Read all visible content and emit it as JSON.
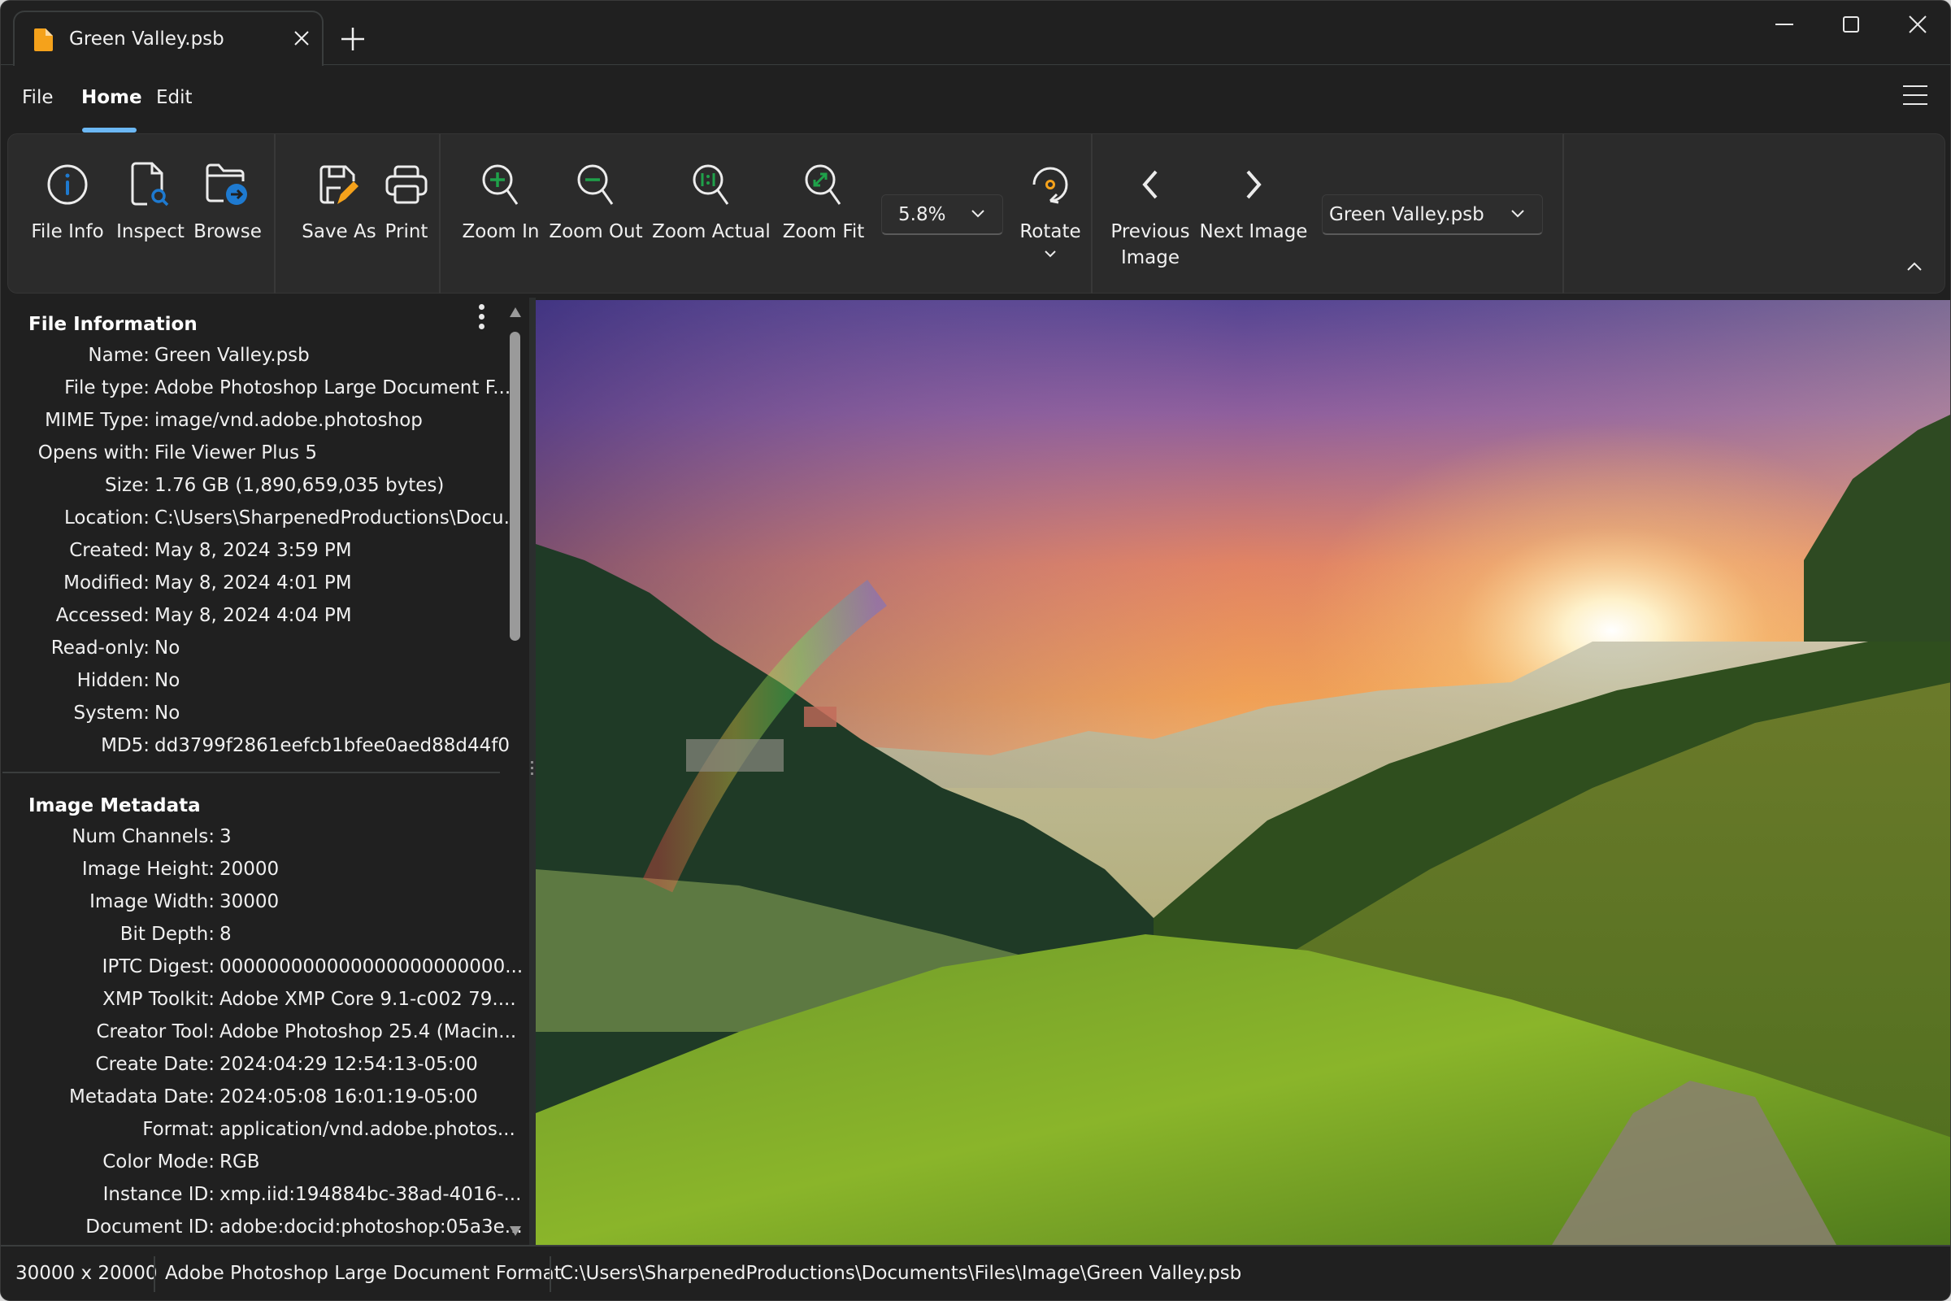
{
  "window": {
    "tab_title": "Green Valley.psb",
    "tab_icon": "document-icon",
    "accent_color": "#6cb8f5",
    "controls": [
      "minimize",
      "maximize",
      "close"
    ]
  },
  "menu": {
    "items": [
      {
        "label": "File"
      },
      {
        "label": "Home",
        "active": true
      },
      {
        "label": "Edit"
      }
    ]
  },
  "ribbon": {
    "groups": [
      {
        "buttons": [
          {
            "label": "File Info",
            "icon": "info-icon"
          },
          {
            "label": "Inspect",
            "icon": "inspect-file-icon"
          },
          {
            "label": "Browse",
            "icon": "browse-folder-icon"
          }
        ]
      },
      {
        "buttons": [
          {
            "label": "Save As",
            "icon": "save-as-icon"
          },
          {
            "label": "Print",
            "icon": "print-icon"
          }
        ]
      },
      {
        "buttons": [
          {
            "label": "Zoom In",
            "icon": "zoom-in-icon"
          },
          {
            "label": "Zoom Out",
            "icon": "zoom-out-icon"
          },
          {
            "label": "Zoom Actual",
            "icon": "zoom-actual-icon"
          },
          {
            "label": "Zoom Fit",
            "icon": "zoom-fit-icon"
          }
        ]
      },
      {
        "buttons": [
          {
            "label": "Previous Image",
            "label_line1": "Previous",
            "label_line2": "Image",
            "icon": "chevron-left-icon"
          },
          {
            "label": "Next Image",
            "icon": "chevron-right-icon"
          }
        ]
      }
    ],
    "zoom_level": "5.8%",
    "rotate_label": "Rotate",
    "image_select": "Green Valley.psb"
  },
  "file_information": {
    "title": "File Information",
    "rows": [
      {
        "key": "Name:",
        "value": "Green Valley.psb"
      },
      {
        "key": "File type:",
        "value": "Adobe Photoshop Large Document F..."
      },
      {
        "key": "MIME Type:",
        "value": "image/vnd.adobe.photoshop"
      },
      {
        "key": "Opens with:",
        "value": "File Viewer Plus 5"
      },
      {
        "key": "Size:",
        "value": "1.76 GB (1,890,659,035 bytes)"
      },
      {
        "key": "Location:",
        "value": "C:\\Users\\SharpenedProductions\\Docu..."
      },
      {
        "key": "Created:",
        "value": "May 8, 2024 3:59 PM"
      },
      {
        "key": "Modified:",
        "value": "May 8, 2024 4:01 PM"
      },
      {
        "key": "Accessed:",
        "value": "May 8, 2024 4:04 PM"
      },
      {
        "key": "Read-only:",
        "value": "No"
      },
      {
        "key": "Hidden:",
        "value": "No"
      },
      {
        "key": "System:",
        "value": "No"
      },
      {
        "key": "MD5:",
        "value": "dd3799f2861eefcb1bfee0aed88d44f0"
      }
    ]
  },
  "image_metadata": {
    "title": "Image Metadata",
    "rows": [
      {
        "key": "Num Channels:",
        "value": "3"
      },
      {
        "key": "Image Height:",
        "value": "20000"
      },
      {
        "key": "Image Width:",
        "value": "30000"
      },
      {
        "key": "Bit Depth:",
        "value": "8"
      },
      {
        "key": "IPTC Digest:",
        "value": "000000000000000000000000..."
      },
      {
        "key": "XMP Toolkit:",
        "value": "Adobe XMP Core 9.1-c002 79...."
      },
      {
        "key": "Creator Tool:",
        "value": "Adobe Photoshop 25.4 (Macin..."
      },
      {
        "key": "Create Date:",
        "value": "2024:04:29 12:54:13-05:00"
      },
      {
        "key": "Metadata Date:",
        "value": "2024:05:08 16:01:19-05:00"
      },
      {
        "key": "Format:",
        "value": "application/vnd.adobe.photos..."
      },
      {
        "key": "Color Mode:",
        "value": "RGB"
      },
      {
        "key": "Instance ID:",
        "value": "xmp.iid:194884bc-38ad-4016-..."
      },
      {
        "key": "Document ID:",
        "value": "adobe:docid:photoshop:05a3e..."
      }
    ]
  },
  "viewer": {
    "image_description": "Sunset over a green mountain valley with fog, a rainbow, a village and a dirt path"
  },
  "status_bar": {
    "dimensions": "30000 x 20000",
    "format": "Adobe Photoshop Large Document Format",
    "path": "C:\\Users\\SharpenedProductions\\Documents\\Files\\Image\\Green Valley.psb"
  }
}
